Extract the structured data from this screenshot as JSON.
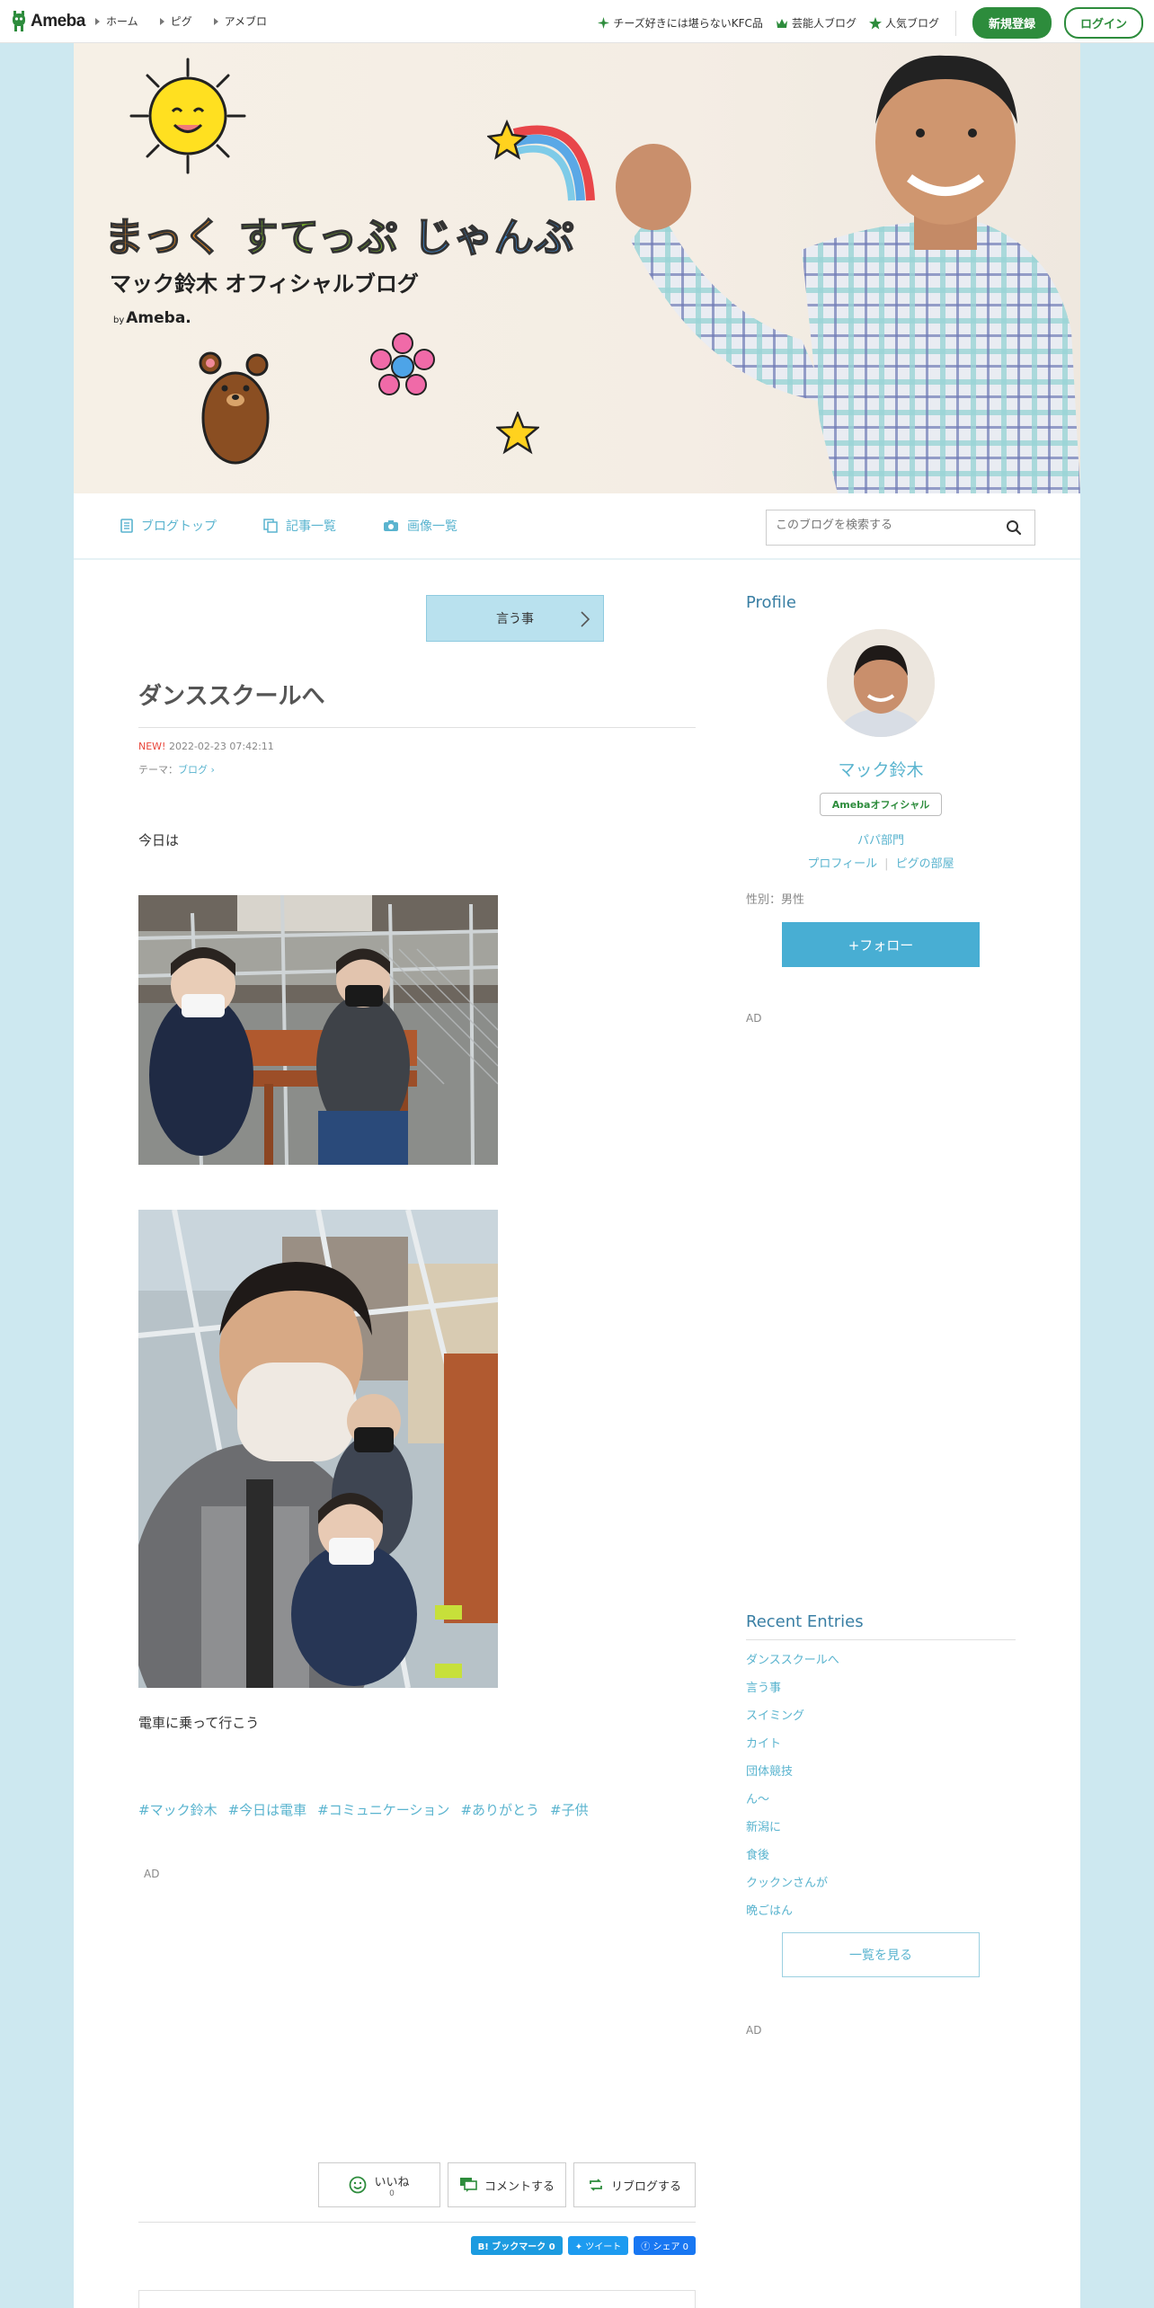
{
  "header": {
    "logo_text": "Ameba",
    "nav": [
      "ホーム",
      "ピグ",
      "アメブロ"
    ],
    "right_links": [
      {
        "label": "チーズ好きには堪らないKFC品",
        "icon": "sparkle-icon"
      },
      {
        "label": "芸能人ブログ",
        "icon": "crown-icon"
      },
      {
        "label": "人気ブログ",
        "icon": "star-icon"
      }
    ],
    "signup_label": "新規登録",
    "login_label": "ログイン",
    "accent": "#2d8c3c"
  },
  "banner": {
    "title_part1": "まっく",
    "title_part2": "すてっぷ",
    "title_part3": "じゃんぷ",
    "subtitle": "マック鈴木  オフィシャルブログ",
    "by": "by",
    "brand": "Ameba."
  },
  "blognav": {
    "items": [
      {
        "label": "ブログトップ",
        "icon": "document-icon"
      },
      {
        "label": "記事一覧",
        "icon": "copy-icon"
      },
      {
        "label": "画像一覧",
        "icon": "camera-icon"
      }
    ],
    "search_placeholder": "このブログを検索する"
  },
  "article": {
    "theme_button": "言う事",
    "title": "ダンススクールへ",
    "new_badge": "NEW!",
    "datetime": "2022-02-23 07:42:11",
    "theme_label": "テーマ：",
    "theme_value": "ブログ",
    "text1": "今日は",
    "text2": "電車に乗って行こう",
    "tags": [
      "#マック鈴木",
      "#今日は電車",
      "#コミュニケーション",
      "#ありがとう",
      "#子供"
    ],
    "ad_label": "AD",
    "like_label": "いいね",
    "like_count": "0",
    "comment_label": "コメントする",
    "reblog_label": "リブログする",
    "share_hatena": "B! ブックマーク  0",
    "share_tweet": "ツイート",
    "share_fb": "シェア 0"
  },
  "sidebar": {
    "profile_heading": "Profile",
    "name": "マック鈴木",
    "official_badge": "Amebaオフィシャル",
    "category": "パパ部門",
    "profile_link": "プロフィール",
    "pig_link": "ピグの部屋",
    "gender": "性別：男性",
    "follow_label": "+フォロー",
    "ad_label": "AD",
    "recent_heading": "Recent Entries",
    "recent": [
      "ダンススクールへ",
      "言う事",
      "スイミング",
      "カイト",
      "団体競技",
      "ん〜",
      "新潟に",
      "食後",
      "クックンさんが",
      "晩ごはん"
    ],
    "see_all": "一覧を見る"
  }
}
